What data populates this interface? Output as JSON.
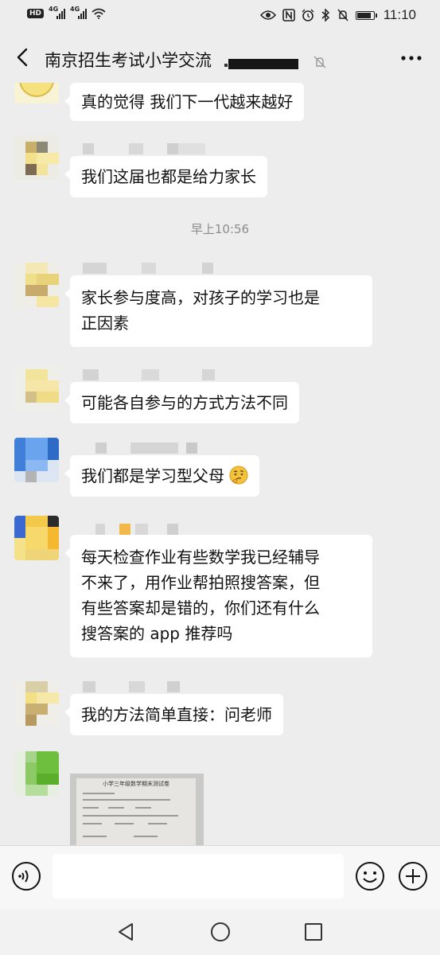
{
  "status_bar": {
    "hd_badge": "HD",
    "network_1": "4G",
    "network_2": "4G",
    "time": "11:10",
    "battery_level": 0.9
  },
  "header": {
    "title": "南京招生考试小学交流"
  },
  "chat": {
    "timestamp": "早上10:56",
    "messages": [
      {
        "text": "真的觉得 我们下一代越来越好"
      },
      {
        "text": "我们这届也都是给力家长"
      },
      {
        "line1": "家长参与度高，对孩子的学习也是",
        "line2": "正因素"
      },
      {
        "text": "可能各自参与的方式方法不同"
      },
      {
        "text": "我们都是学习型父母",
        "emoji": "thinking-face"
      },
      {
        "line1": "每天检查作业有些数学我已经辅导",
        "line2": "不来了，用作业帮拍照搜答案，但",
        "line3": "有些答案却是错的，你们还有什么",
        "line4": "搜答案的 app 推荐吗"
      },
      {
        "text": "我的方法简单直接：问老师"
      }
    ],
    "image_message": {
      "title": "小学三年级数学期末测试卷"
    }
  },
  "input_bar": {
    "placeholder": ""
  },
  "colors": {
    "background": "#ededed",
    "bubble": "#ffffff",
    "timestamp": "#8c8c8c"
  }
}
